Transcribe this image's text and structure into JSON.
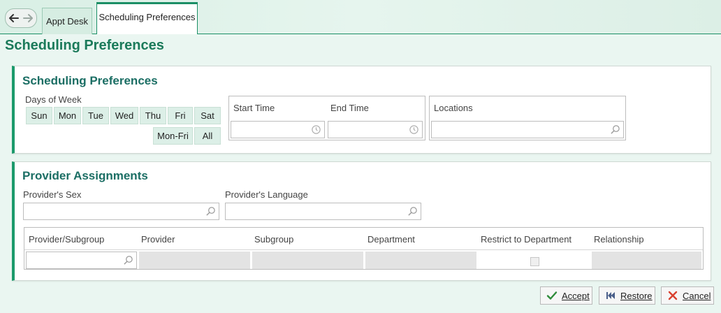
{
  "nav": {
    "back_icon": "back-arrow-icon",
    "forward_icon": "forward-arrow-icon"
  },
  "tabs": [
    {
      "label": "Appt Desk",
      "active": false
    },
    {
      "label": "Scheduling Preferences",
      "active": true
    }
  ],
  "page_title": "Scheduling Preferences",
  "scheduling": {
    "title": "Scheduling Preferences",
    "days_label": "Days of Week",
    "days": [
      "Sun",
      "Mon",
      "Tue",
      "Wed",
      "Thu",
      "Fri",
      "Sat"
    ],
    "day_groups": [
      "Mon-Fri",
      "All"
    ],
    "start_time_label": "Start Time",
    "end_time_label": "End Time",
    "start_time_value": "",
    "end_time_value": "",
    "locations_label": "Locations",
    "locations_value": ""
  },
  "provider": {
    "title": "Provider Assignments",
    "sex_label": "Provider's Sex",
    "sex_value": "",
    "language_label": "Provider's Language",
    "language_value": "",
    "columns": [
      "Provider/Subgroup",
      "Provider",
      "Subgroup",
      "Department",
      "Restrict to Department",
      "Relationship"
    ],
    "row": {
      "provider_subgroup": "",
      "restrict_checked": false
    }
  },
  "buttons": {
    "accept": "Accept",
    "restore": "Restore",
    "cancel": "Cancel"
  },
  "colors": {
    "accent": "#1b9a6b",
    "title": "#1b6e64",
    "tab_bg": "#d6ede2"
  }
}
